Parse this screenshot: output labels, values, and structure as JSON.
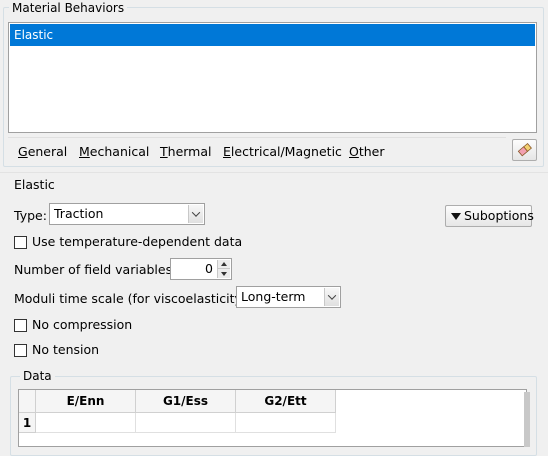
{
  "material_behaviors": {
    "title": "Material Behaviors",
    "items": [
      "Elastic"
    ],
    "selected": "Elastic"
  },
  "menu": [
    {
      "label": "General",
      "mnemonic": "G",
      "rest": "eneral"
    },
    {
      "label": "Mechanical",
      "mnemonic": "M",
      "rest": "echanical"
    },
    {
      "label": "Thermal",
      "mnemonic": "T",
      "rest": "hermal"
    },
    {
      "label": "Electrical/Magnetic",
      "mnemonic": "E",
      "rest": "lectrical/Magnetic"
    },
    {
      "label": "Other",
      "mnemonic": "O",
      "rest": "ther"
    }
  ],
  "eraser_button": {
    "icon": "eraser-icon"
  },
  "elastic": {
    "title": "Elastic",
    "type_label": "Type:",
    "type_value": "Traction",
    "suboptions_label": "Suboptions",
    "temp_dependent_label": "Use temperature-dependent data",
    "temp_dependent_checked": false,
    "field_vars_label": "Number of field variables:",
    "field_vars_value": "0",
    "moduli_label": "Moduli time scale (for viscoelasticity):",
    "moduli_value": "Long-term",
    "no_compression_label": "No compression",
    "no_compression_checked": false,
    "no_tension_label": "No tension",
    "no_tension_checked": false
  },
  "data_table": {
    "title": "Data",
    "columns": [
      "E/Enn",
      "G1/Ess",
      "G2/Ett"
    ],
    "rows": [
      {
        "index": "1",
        "cells": [
          "",
          "",
          ""
        ]
      }
    ]
  },
  "colors": {
    "selection": "#0078d7",
    "background": "#f0f0f0"
  }
}
